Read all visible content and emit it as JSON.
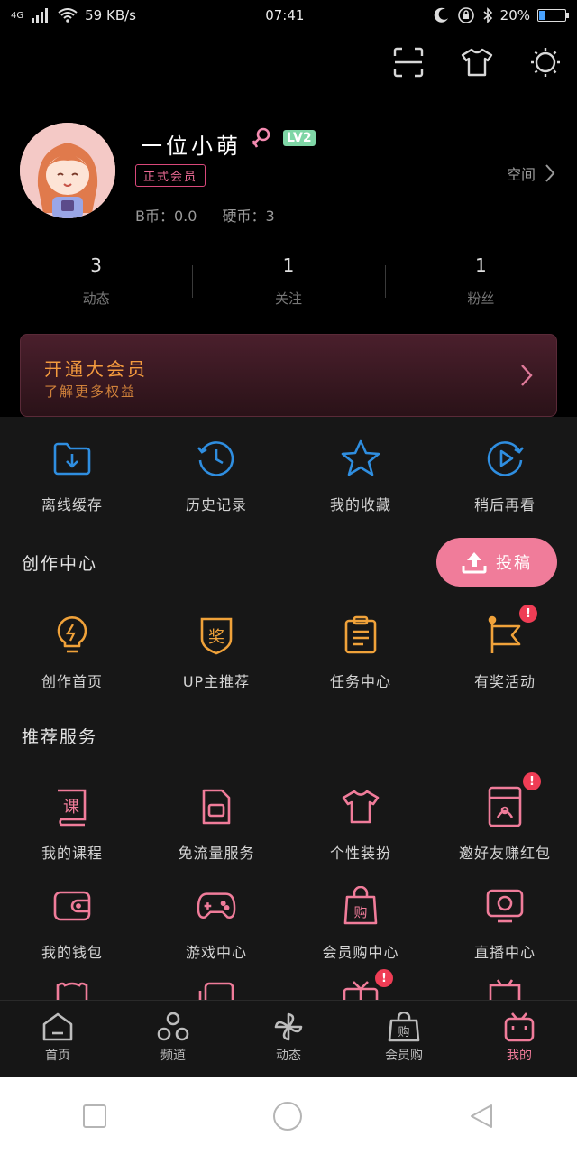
{
  "status_bar": {
    "network": "4G",
    "speed": "59 KB/s",
    "time": "07:41",
    "battery": "20%",
    "battery_level": 0.2
  },
  "top_icons": [
    "scan-icon",
    "tshirt-icon",
    "theme-icon"
  ],
  "profile": {
    "name": "一位小萌",
    "level": "LV2",
    "vip_badge": "正式会员",
    "b_coins": "B币：0.0",
    "hard_coins": "硬币：3",
    "space_link": "空间"
  },
  "stats": [
    {
      "value": "3",
      "label": "动态"
    },
    {
      "value": "1",
      "label": "关注"
    },
    {
      "value": "1",
      "label": "粉丝"
    }
  ],
  "vip_banner": {
    "title": "开通大会员",
    "subtitle": "了解更多权益"
  },
  "quick_actions": [
    {
      "label": "离线缓存",
      "icon": "download-folder-icon"
    },
    {
      "label": "历史记录",
      "icon": "history-clock-icon"
    },
    {
      "label": "我的收藏",
      "icon": "star-icon"
    },
    {
      "label": "稍后再看",
      "icon": "play-later-icon"
    }
  ],
  "creation": {
    "title": "创作中心",
    "publish_label": "投稿",
    "items": [
      {
        "label": "创作首页",
        "icon": "lightbulb-icon"
      },
      {
        "label": "UP主推荐",
        "icon": "award-badge-icon"
      },
      {
        "label": "任务中心",
        "icon": "clipboard-icon"
      },
      {
        "label": "有奖活动",
        "icon": "flag-icon",
        "badge": "!"
      }
    ]
  },
  "services": {
    "title": "推荐服务",
    "items": [
      {
        "label": "我的课程",
        "icon": "course-book-icon"
      },
      {
        "label": "免流量服务",
        "icon": "sim-card-icon"
      },
      {
        "label": "个性装扮",
        "icon": "tshirt-icon"
      },
      {
        "label": "邀好友赚红包",
        "icon": "red-packet-icon",
        "badge": "!"
      },
      {
        "label": "我的钱包",
        "icon": "wallet-icon"
      },
      {
        "label": "游戏中心",
        "icon": "gamepad-icon"
      },
      {
        "label": "会员购中心",
        "icon": "shopping-bag-icon"
      },
      {
        "label": "直播中心",
        "icon": "live-tv-icon"
      }
    ]
  },
  "bottom_nav": [
    {
      "label": "首页",
      "icon": "home-icon"
    },
    {
      "label": "频道",
      "icon": "channel-icon"
    },
    {
      "label": "动态",
      "icon": "pinwheel-icon"
    },
    {
      "label": "会员购",
      "icon": "shop-bag-icon"
    },
    {
      "label": "我的",
      "icon": "tv-mascot-icon",
      "active": true
    }
  ],
  "colors": {
    "accent_pink": "#f07c9a",
    "blue": "#2f8ee0",
    "orange": "#f0a23a",
    "gold": "#f39a3e"
  }
}
